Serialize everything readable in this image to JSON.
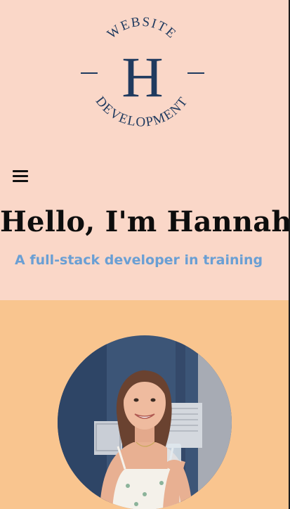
{
  "logo": {
    "top_text": "WEBSITE",
    "monogram": "H",
    "bottom_text": "DEVELOPMENT"
  },
  "nav": {
    "menu_icon": "hamburger-menu-icon"
  },
  "hero": {
    "headline": "Hello, I'm Hannah!",
    "tagline": "A full-stack developer in training"
  },
  "colors": {
    "hero_bg": "#fad7c8",
    "about_bg": "#f9c58f",
    "logo_navy": "#1f3a5f",
    "tagline_blue": "#6a9fd4"
  },
  "about": {
    "portrait_icon": "profile-photo"
  }
}
